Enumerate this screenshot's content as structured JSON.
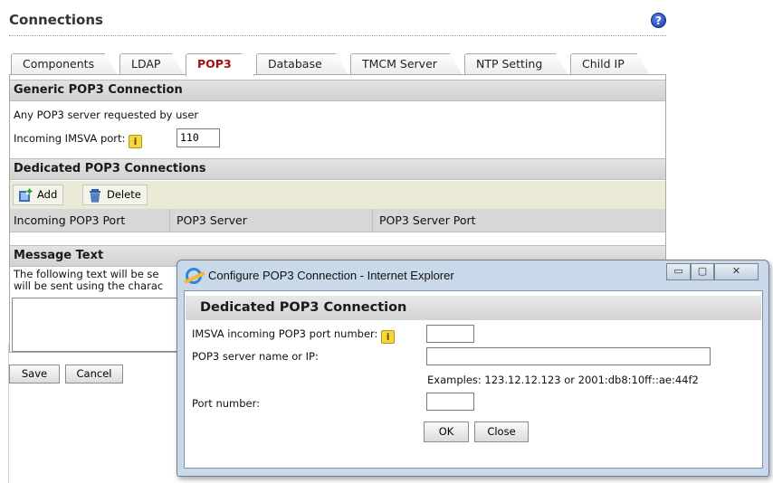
{
  "page": {
    "title": "Connections",
    "help_icon": "help-icon"
  },
  "tabs": [
    {
      "label": "Components"
    },
    {
      "label": "LDAP"
    },
    {
      "label": "POP3",
      "active": true
    },
    {
      "label": "Database"
    },
    {
      "label": "TMCM Server"
    },
    {
      "label": "NTP Setting"
    },
    {
      "label": "Child IP"
    }
  ],
  "generic": {
    "heading": "Generic POP3 Connection",
    "description": "Any POP3 server requested by user",
    "port_label": "Incoming IMSVA port:",
    "port_value": "110"
  },
  "dedicated": {
    "heading": "Dedicated POP3 Connections",
    "add_label": "Add",
    "delete_label": "Delete",
    "columns": [
      "Incoming POP3 Port",
      "POP3 Server",
      "POP3 Server Port"
    ]
  },
  "message": {
    "heading": "Message Text",
    "line1": "The following text will be se",
    "line2": "will be sent using the charac"
  },
  "buttons": {
    "save": "Save",
    "cancel": "Cancel"
  },
  "dialog": {
    "window_title": "Configure POP3 Connection - Internet Explorer",
    "heading": "Dedicated POP3 Connection",
    "port_label": "IMSVA incoming POP3 port number:",
    "server_label": "POP3 server name or IP:",
    "examples": "Examples: 123.12.12.123 or 2001:db8:10ff::ae:44f2",
    "port_number_label": "Port number:",
    "ok": "OK",
    "close": "Close",
    "minimize_glyph": "▭",
    "maximize_glyph": "▢",
    "close_glyph": "✕"
  },
  "colors": {
    "active_tab": "#a61010",
    "dialog_frame": "#c9d9ea",
    "toolbar": "#ebead6"
  }
}
